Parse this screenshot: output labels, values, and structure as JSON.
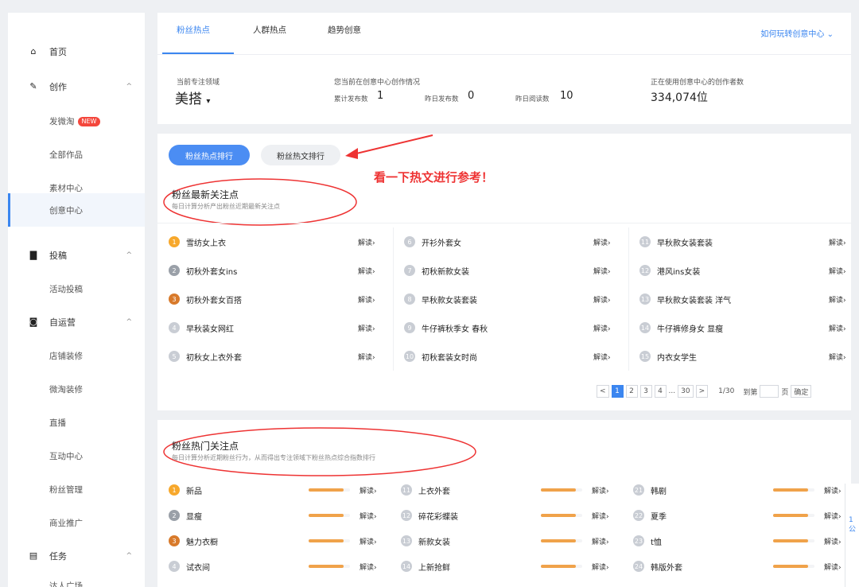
{
  "sidebar": {
    "home": "首页",
    "create": "创作",
    "publish_weitao": "发微淘",
    "new_badge": "NEW",
    "all_works": "全部作品",
    "material_center": "素材中心",
    "creative_center": "创意中心",
    "submit": "投稿",
    "activity_submit": "活动投稿",
    "self_operate": "自运营",
    "shop_decor": "店铺装修",
    "weitao_decor": "微淘装修",
    "live": "直播",
    "interact_center": "互动中心",
    "fans_manage": "粉丝管理",
    "biz_promo": "商业推广",
    "tasks": "任务",
    "talent_square": "达人广场"
  },
  "tabs": [
    "粉丝热点",
    "人群热点",
    "趋势创意"
  ],
  "help_link": "如何玩转创意中心",
  "stats": {
    "domain_caption": "当前专注领域",
    "domain_value": "美搭",
    "creation_caption": "您当前在创意中心创作情况",
    "total_label": "累计发布数",
    "total_value": "1",
    "yesterday_pub_label": "昨日发布数",
    "yesterday_pub_value": "0",
    "yesterday_read_label": "昨日阅读数",
    "yesterday_read_value": "10",
    "users_caption": "正在使用创意中心的创作者数",
    "users_value": "334,074位"
  },
  "section1": {
    "btn_hotspot_rank": "粉丝热点排行",
    "btn_hotarticle_rank": "粉丝热文排行",
    "annotation": "看一下热文进行参考！",
    "title": "粉丝最新关注点",
    "subtitle": "每日计算分析产出粉丝近期最新关注点",
    "read_label": "解读›",
    "items": [
      {
        "rank": "1",
        "text": "雪纺女上衣"
      },
      {
        "rank": "2",
        "text": "初秋外套女ins"
      },
      {
        "rank": "3",
        "text": "初秋外套女百搭"
      },
      {
        "rank": "4",
        "text": "早秋装女网红"
      },
      {
        "rank": "5",
        "text": "初秋女上衣外套"
      },
      {
        "rank": "6",
        "text": "开衫外套女"
      },
      {
        "rank": "7",
        "text": "初秋新款女装"
      },
      {
        "rank": "8",
        "text": "早秋款女装套装"
      },
      {
        "rank": "9",
        "text": "牛仔裤秋季女 春秋"
      },
      {
        "rank": "10",
        "text": "初秋套装女时尚"
      },
      {
        "rank": "11",
        "text": "早秋款女装套装"
      },
      {
        "rank": "12",
        "text": "港风ins女装"
      },
      {
        "rank": "13",
        "text": "早秋款女装套装 洋气"
      },
      {
        "rank": "14",
        "text": "牛仔裤修身女 显瘦"
      },
      {
        "rank": "15",
        "text": "内衣女学生"
      }
    ],
    "pager": {
      "prev": "<",
      "pages": [
        "1",
        "2",
        "3",
        "4",
        "...",
        "30"
      ],
      "next": ">",
      "count": "1/30",
      "goto": "到第",
      "page_unit": "页",
      "confirm": "确定"
    }
  },
  "section2": {
    "title": "粉丝热门关注点",
    "subtitle": "每日计算分析近期粉丝行为，从而得出专注领域下粉丝热点综合指数排行",
    "read_label": "解读›",
    "items": [
      {
        "rank": "1",
        "text": "新品",
        "level": 0.85
      },
      {
        "rank": "2",
        "text": "显瘦",
        "level": 0.85
      },
      {
        "rank": "3",
        "text": "魅力衣橱",
        "level": 0.85
      },
      {
        "rank": "4",
        "text": "试衣间",
        "level": 0.85
      },
      {
        "rank": "11",
        "text": "上衣外套",
        "level": 0.85
      },
      {
        "rank": "12",
        "text": "碎花彩蝶装",
        "level": 0.85
      },
      {
        "rank": "13",
        "text": "新款女装",
        "level": 0.85
      },
      {
        "rank": "14",
        "text": "上新抢鲜",
        "level": 0.85
      },
      {
        "rank": "21",
        "text": "韩剧",
        "level": 0.85
      },
      {
        "rank": "22",
        "text": "夏季",
        "level": 0.85
      },
      {
        "rank": "23",
        "text": "t恤",
        "level": 0.85
      },
      {
        "rank": "24",
        "text": "韩版外套",
        "level": 0.85
      }
    ]
  },
  "float_widget": "1公"
}
